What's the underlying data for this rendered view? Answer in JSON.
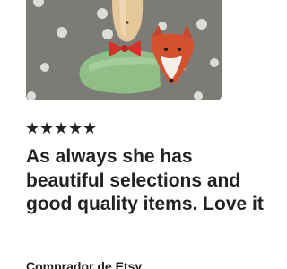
{
  "review": {
    "rating": 5,
    "rating_max": 5,
    "stars": [
      "★",
      "★",
      "★",
      "★",
      "★"
    ],
    "text": "As always she has beautiful selections and good quality items. Love it",
    "reviewer": "Comprador de Etsy"
  },
  "photo": {
    "subject": "handmade ceramic ornament with red bow tie, green body and fox head on polka-dot background"
  },
  "colors": {
    "text": "#222222",
    "background": "#ffffff",
    "photo_bg": "#7c7b76"
  }
}
